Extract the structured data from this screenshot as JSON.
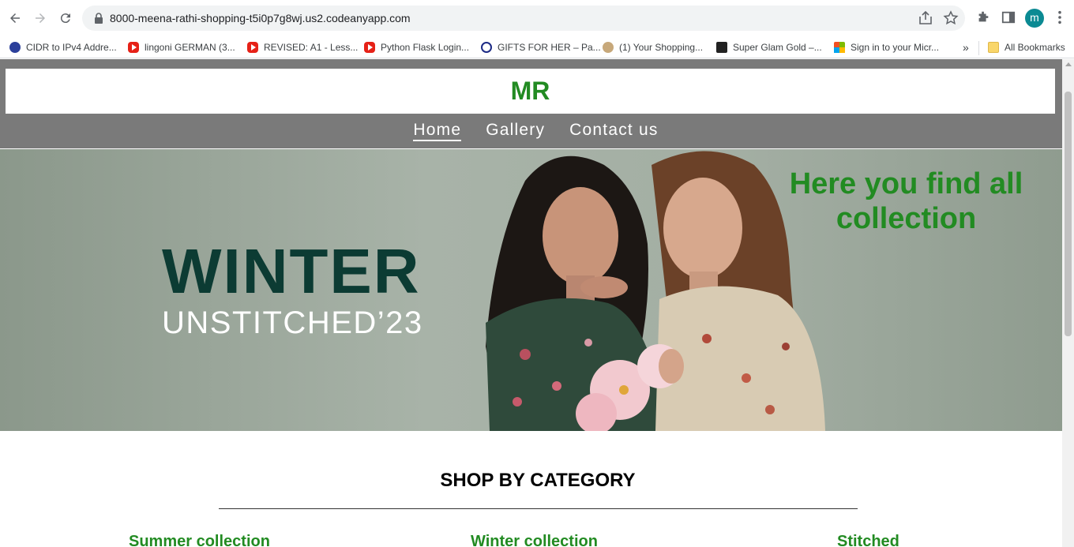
{
  "browser": {
    "url": "8000-meena-rathi-shopping-t5i0p7g8wj.us2.codeanyapp.com",
    "avatar_letter": "m",
    "bookmarks": [
      {
        "label": "CIDR to IPv4 Addre...",
        "icon": "cidr-icon"
      },
      {
        "label": "lingoni GERMAN (3...",
        "icon": "youtube-icon"
      },
      {
        "label": "REVISED: A1 - Less...",
        "icon": "youtube-icon"
      },
      {
        "label": "Python Flask Login...",
        "icon": "youtube-icon"
      },
      {
        "label": "GIFTS FOR HER – Pa...",
        "icon": "s-logo-icon"
      },
      {
        "label": "(1) Your Shopping...",
        "icon": "shop-icon"
      },
      {
        "label": "Super Glam Gold –...",
        "icon": "one-logo-icon"
      },
      {
        "label": "Sign in to your Micr...",
        "icon": "microsoft-icon"
      }
    ],
    "overflow_label": "»",
    "all_bookmarks": "All Bookmarks"
  },
  "site": {
    "logo": "MR",
    "nav": [
      {
        "label": "Home",
        "active": true
      },
      {
        "label": "Gallery",
        "active": false
      },
      {
        "label": "Contact us",
        "active": false
      }
    ],
    "hero": {
      "headline": "WINTER",
      "subline": "UNSTITCHED’23",
      "tagline": "Here you find all collection"
    },
    "section_title": "SHOP BY CATEGORY",
    "categories": [
      "Summer collection",
      "Winter collection",
      "Stitched"
    ]
  },
  "colors": {
    "brand_green": "#228b22",
    "nav_bar": "#7a7a7a",
    "hero_dark_green": "#0c3b33"
  }
}
